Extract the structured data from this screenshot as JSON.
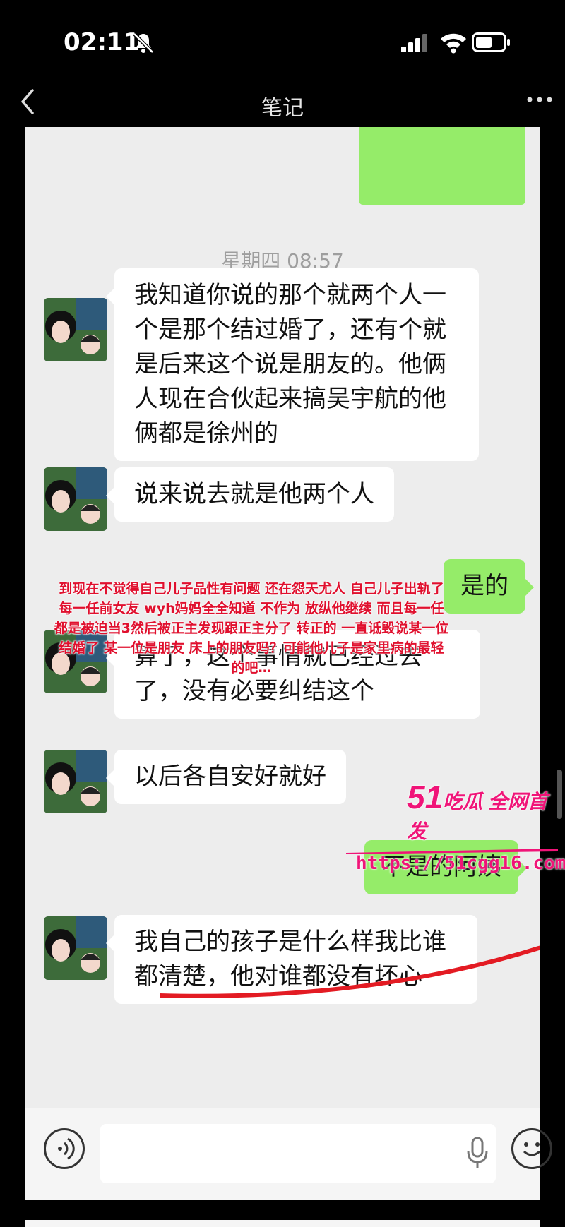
{
  "status": {
    "time": "02:11"
  },
  "nav": {
    "title": "笔记"
  },
  "chat": {
    "timestamp": "星期四 08:57",
    "messages": [
      {
        "side": "left",
        "text": "我知道你说的那个就两个人一个是那个结过婚了，还有个就是后来这个说是朋友的。他俩人现在合伙起来搞吴宇航的他俩都是徐州的"
      },
      {
        "side": "left",
        "text": "说来说去就是他两个人"
      },
      {
        "side": "right",
        "text": "是的"
      },
      {
        "side": "left",
        "text": "算了，这个事情就已经过去了，没有必要纠结这个"
      },
      {
        "side": "left",
        "text": "以后各自安好就好"
      },
      {
        "side": "right",
        "text": "不是的阿姨"
      },
      {
        "side": "left",
        "text": "我自己的孩子是什么样我比谁都清楚，他对谁都没有坏心"
      }
    ]
  },
  "overlay": {
    "text": "到现在不觉得自己儿子品性有问题 还在怨天尤人 自己儿子出轨了每一任前女友 wyh妈妈全全知道 不作为 放纵他继续 而且每一任都是被迫当3然后被正主发现跟正主分了 转正的 一直诋毁说某一位结婚了 某一位是朋友 床上的朋友吗？可能他儿子是家里病的最轻的吧…",
    "color": "#e0102e"
  },
  "watermark": {
    "brand_num": "51",
    "brand_text": "吃瓜 全网首发",
    "url": "https://51cgg16.com",
    "color": "#f01478"
  },
  "colors": {
    "bubble_green": "#95ec69",
    "chat_bg": "#ededed"
  }
}
